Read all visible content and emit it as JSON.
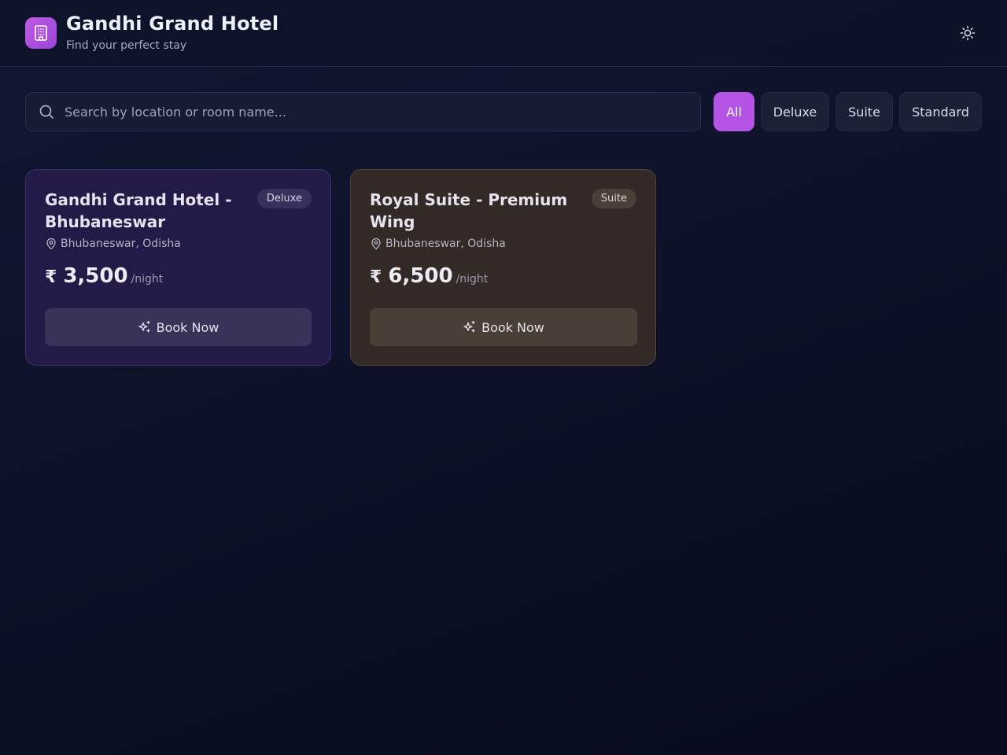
{
  "header": {
    "title": "Gandhi Grand Hotel",
    "subtitle": "Find your perfect stay",
    "logo_icon": "building-icon",
    "theme_toggle_icon": "sun-icon"
  },
  "search": {
    "placeholder": "Search by location or room name...",
    "value": "",
    "icon": "search-icon"
  },
  "filters": {
    "all": "All",
    "deluxe": "Deluxe",
    "suite": "Suite",
    "standard": "Standard",
    "active": "All"
  },
  "rooms": [
    {
      "title": "Gandhi Grand Hotel - Bhubaneswar",
      "badge": "Deluxe",
      "location": "Bhubaneswar, Odisha",
      "currency": "₹",
      "price": "3,500",
      "per": "/night",
      "button": "Book Now"
    },
    {
      "title": "Royal Suite - Premium Wing",
      "badge": "Suite",
      "location": "Bhubaneswar, Odisha",
      "currency": "₹",
      "price": "6,500",
      "per": "/night",
      "button": "Book Now"
    }
  ],
  "colors": {
    "accent": "#b553e6",
    "deluxe_card": "#241a47",
    "suite_card": "#332a27",
    "background": "#0e1229"
  }
}
